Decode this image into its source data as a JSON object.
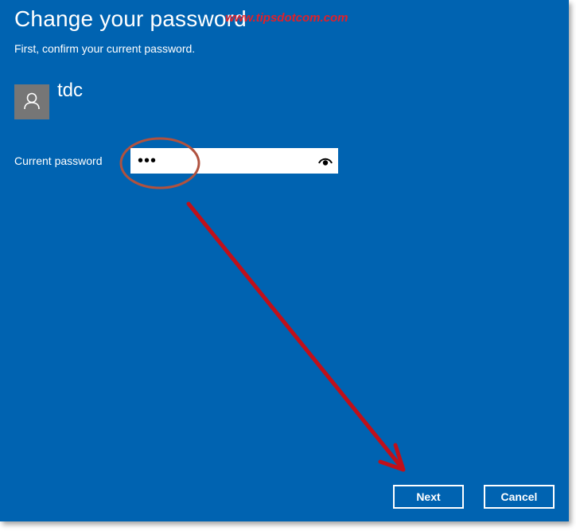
{
  "dialog": {
    "title": "Change your password",
    "subtitle": "First, confirm your current password.",
    "watermark": "www.tipsdotcom.com"
  },
  "account": {
    "username": "tdc",
    "avatar_icon": "person-icon"
  },
  "password_field": {
    "label": "Current password",
    "masked_value": "•••",
    "reveal_icon": "eye-icon"
  },
  "buttons": {
    "next_label": "Next",
    "cancel_label": "Cancel"
  },
  "annotations": {
    "circle_color": "#b0523f",
    "arrow_color": "#c0101a"
  },
  "colors": {
    "background": "#0063b1",
    "avatar_bg": "#767676",
    "text": "#ffffff"
  }
}
